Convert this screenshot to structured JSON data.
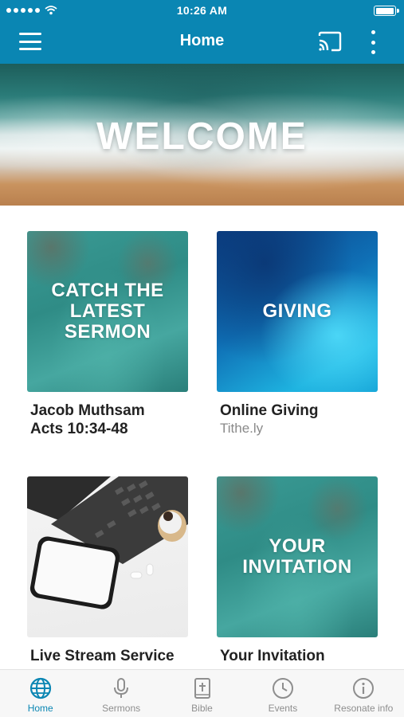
{
  "status_bar": {
    "time": "10:26 AM"
  },
  "nav": {
    "title": "Home"
  },
  "hero": {
    "text": "WELCOME"
  },
  "cards": [
    {
      "overlay": "CATCH THE\nLATEST\nSERMON",
      "title": "Jacob Muthsam\nActs 10:34-48",
      "subtitle": ""
    },
    {
      "overlay": "GIVING",
      "title": "Online Giving",
      "subtitle": "Tithe.ly"
    },
    {
      "overlay": "",
      "title": "Live Stream Service",
      "subtitle": ""
    },
    {
      "overlay": "YOUR\nINVITATION",
      "title": "Your Invitation",
      "subtitle": ""
    }
  ],
  "tabs": [
    {
      "label": "Home",
      "icon": "globe-icon",
      "active": true
    },
    {
      "label": "Sermons",
      "icon": "microphone-icon",
      "active": false
    },
    {
      "label": "Bible",
      "icon": "bible-icon",
      "active": false
    },
    {
      "label": "Events",
      "icon": "clock-icon",
      "active": false
    },
    {
      "label": "Resonate info",
      "icon": "info-icon",
      "active": false
    }
  ],
  "colors": {
    "brand": "#0a86b3",
    "tab_inactive": "#8e8e8e"
  }
}
